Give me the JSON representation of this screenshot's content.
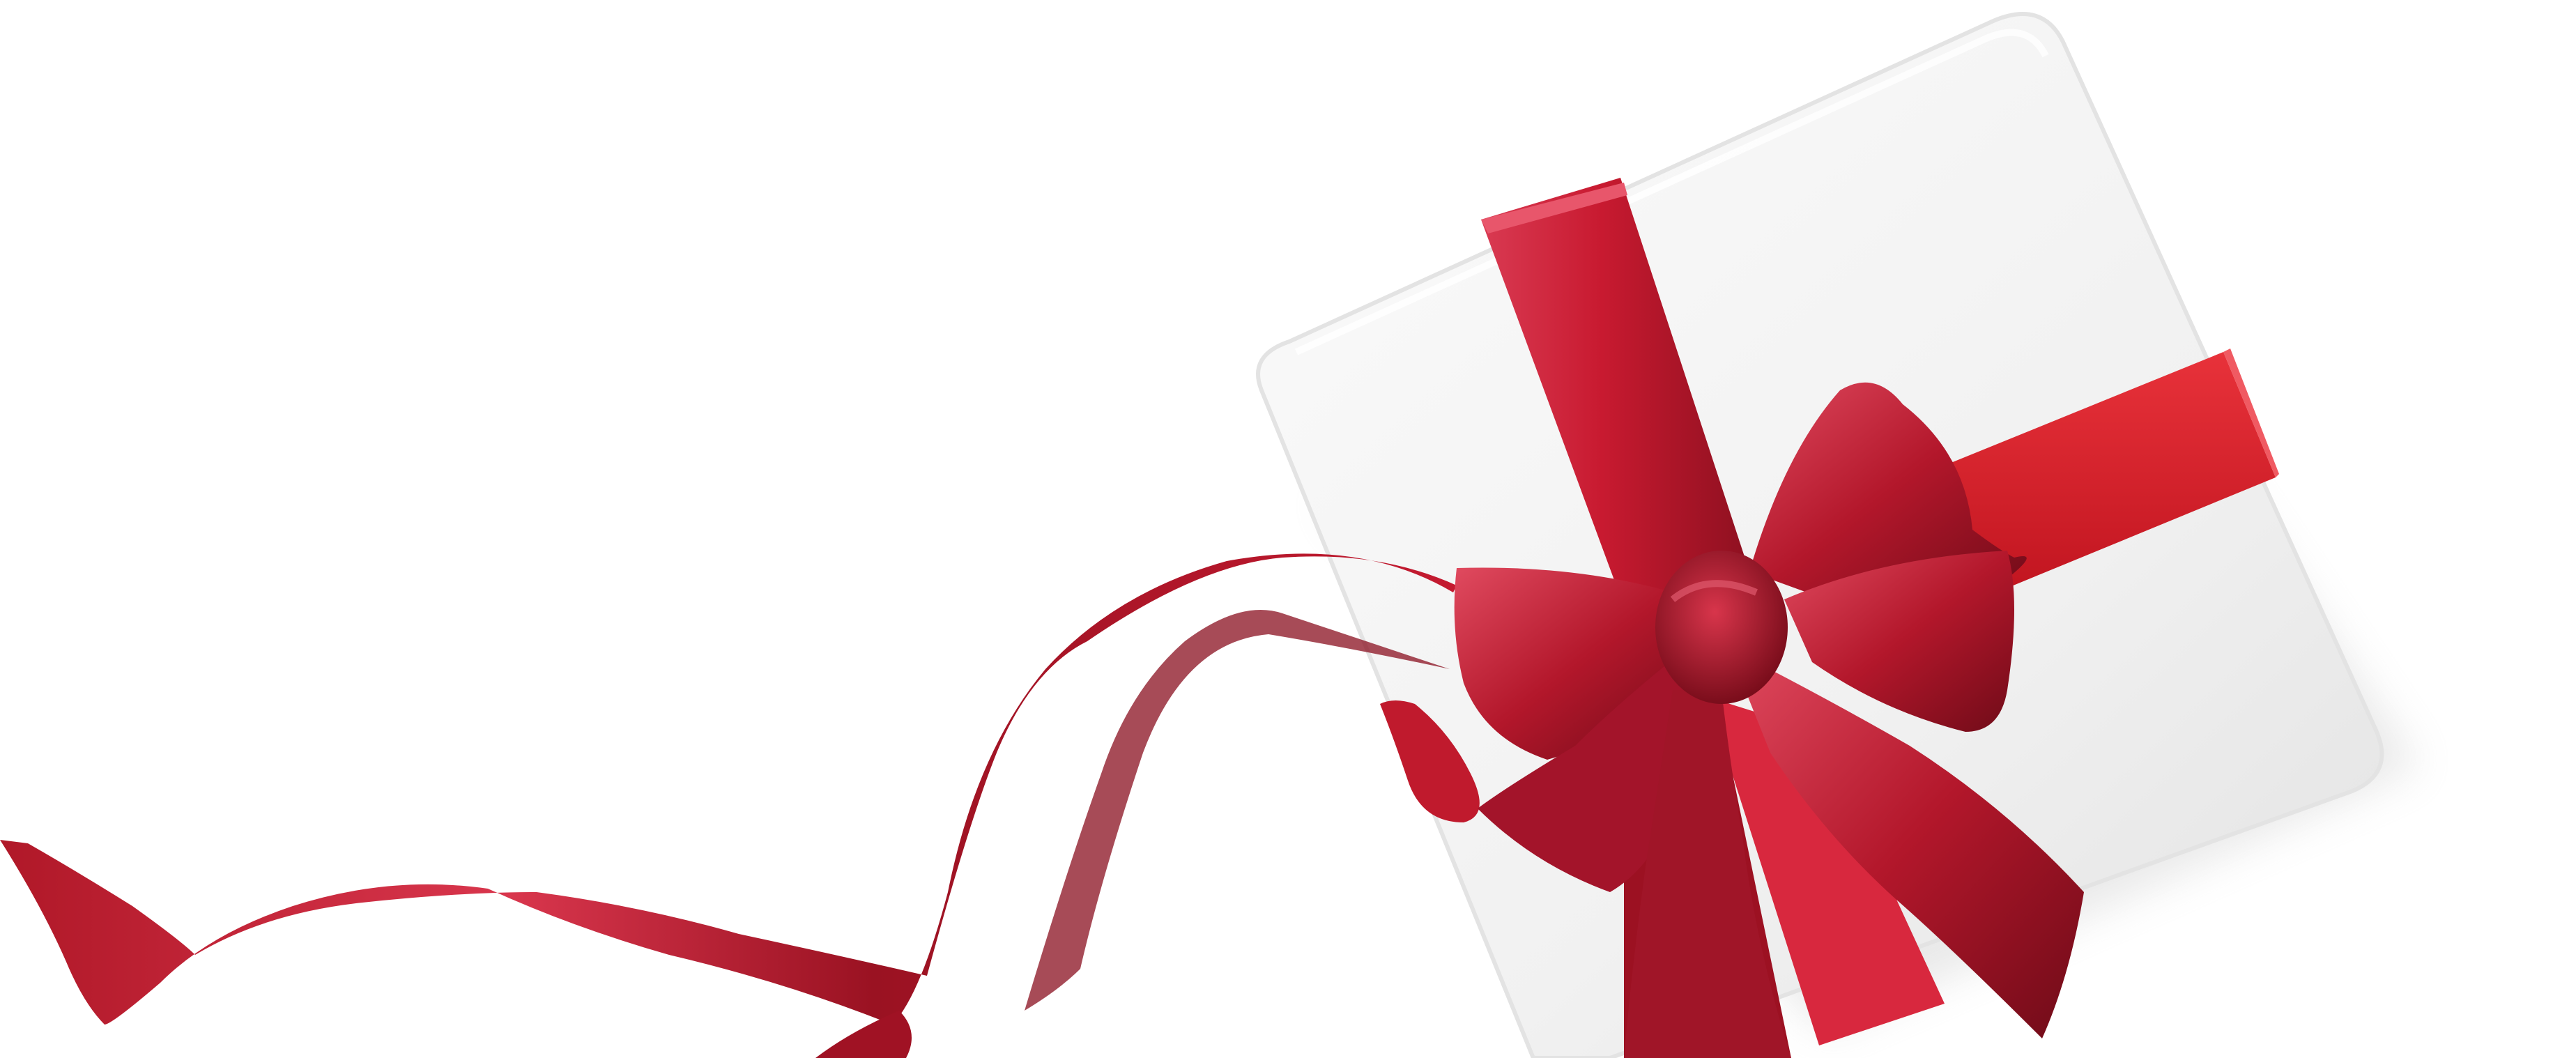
{
  "image": {
    "subject": "gift-box-with-red-ribbon-bow",
    "colors": {
      "background": "#ffffff",
      "box": "#f3f3f3",
      "box_edge": "#e4e4e4",
      "ribbon": "#c8172e",
      "ribbon_light": "#e2495f",
      "ribbon_dark": "#7d0f1d",
      "ribbon_bright": "#e01e2a"
    }
  }
}
